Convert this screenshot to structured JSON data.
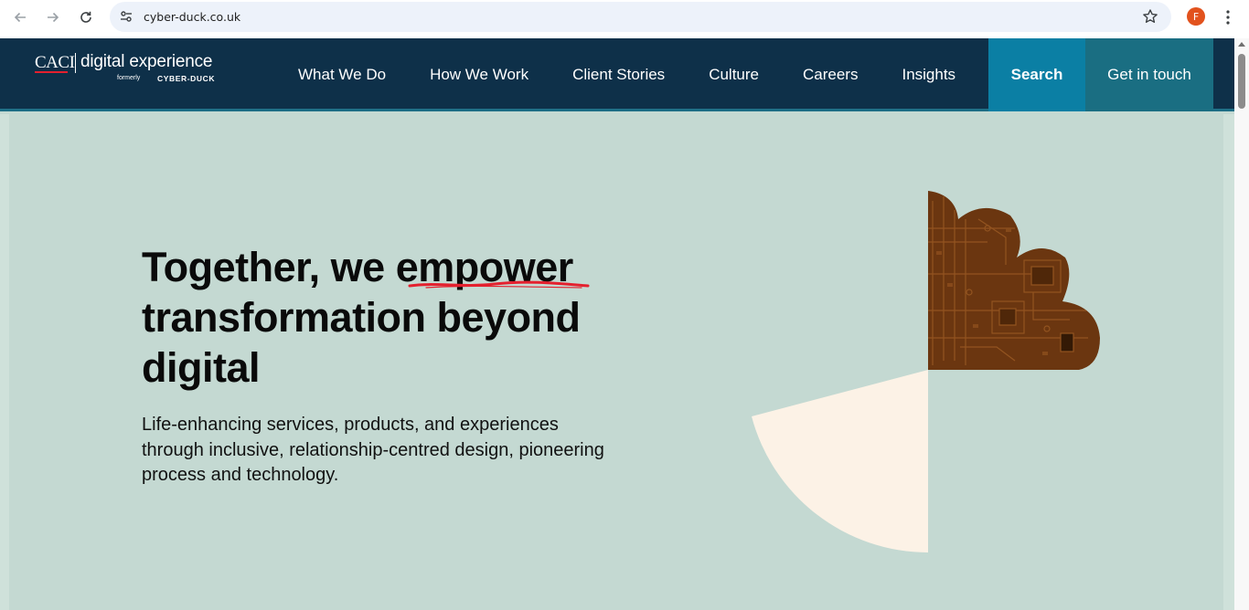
{
  "browser": {
    "url": "cyber-duck.co.uk",
    "profile_initial": "F"
  },
  "header": {
    "logo": {
      "brand": "CACI",
      "name": "digital experience",
      "formerly": "formerly",
      "former_brand": "CYBER-DUCK"
    },
    "menu": [
      {
        "label": "What We Do"
      },
      {
        "label": "How We Work"
      },
      {
        "label": "Client Stories"
      },
      {
        "label": "Culture"
      },
      {
        "label": "Careers"
      },
      {
        "label": "Insights"
      }
    ],
    "search_label": "Search",
    "contact_label": "Get in touch"
  },
  "hero": {
    "title_part1": "Together, we ",
    "title_emphasis": "empower",
    "title_part2": "transformation beyond digital",
    "subtitle": "Life-enhancing services, products, and experiences through inclusive, relationship-centred design, pioneering process and technology."
  },
  "colors": {
    "header_bg": "#0e3049",
    "search_bg": "#0b7fa4",
    "contact_bg": "#1a6e82",
    "hero_bg": "#c4d9d2",
    "accent_red": "#e4202e",
    "circuit_brown": "#6b3610",
    "pie_cream": "#fcf2e6"
  }
}
